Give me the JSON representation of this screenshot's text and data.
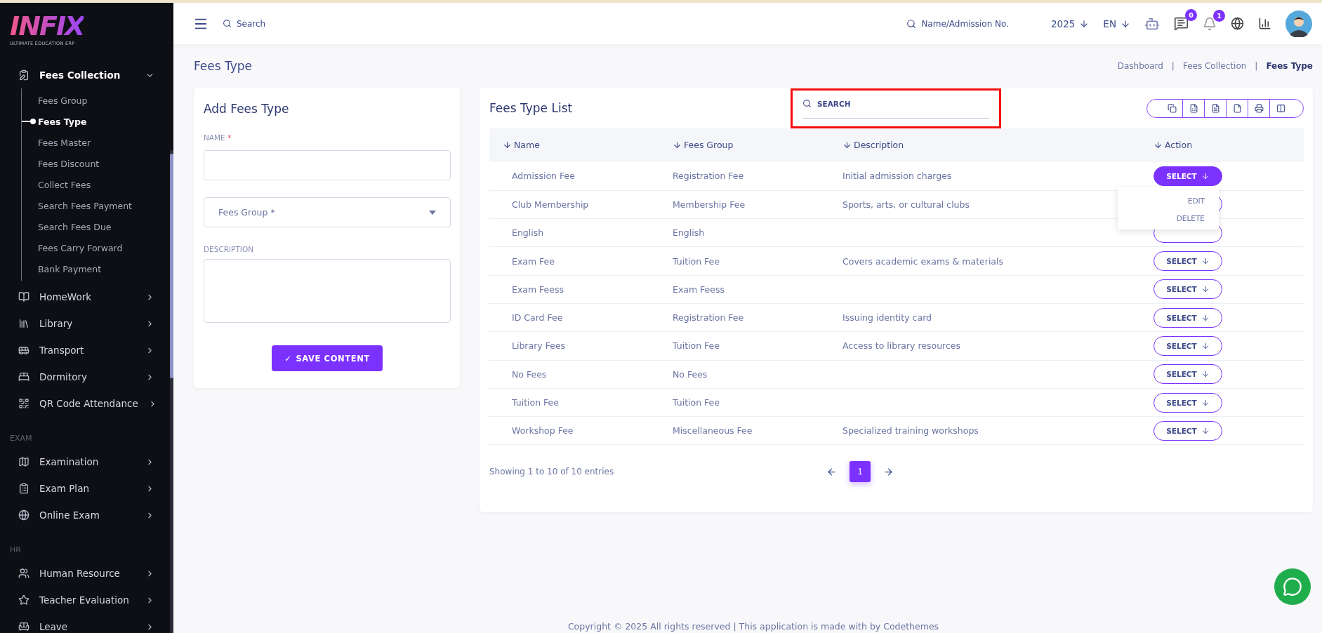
{
  "sidebar": {
    "logo": {
      "brand": "INFIX",
      "tagline": "ULTIMATE EDUCATION ERP"
    },
    "sections": [
      {
        "items": [
          {
            "label": "Fees Collection",
            "expanded": true,
            "children": [
              {
                "label": "Fees Group",
                "selected": false
              },
              {
                "label": "Fees Type",
                "selected": true
              },
              {
                "label": "Fees Master",
                "selected": false
              },
              {
                "label": "Fees Discount",
                "selected": false
              },
              {
                "label": "Collect Fees",
                "selected": false
              },
              {
                "label": "Search Fees Payment",
                "selected": false
              },
              {
                "label": "Search Fees Due",
                "selected": false
              },
              {
                "label": "Fees Carry Forward",
                "selected": false
              },
              {
                "label": "Bank Payment",
                "selected": false
              }
            ]
          },
          {
            "label": "HomeWork",
            "expanded": false
          },
          {
            "label": "Library",
            "expanded": false
          },
          {
            "label": "Transport",
            "expanded": false
          },
          {
            "label": "Dormitory",
            "expanded": false
          },
          {
            "label": "QR Code Attendance",
            "expanded": false
          }
        ]
      },
      {
        "heading": "EXAM",
        "items": [
          {
            "label": "Examination",
            "expanded": false
          },
          {
            "label": "Exam Plan",
            "expanded": false
          },
          {
            "label": "Online Exam",
            "expanded": false
          }
        ]
      },
      {
        "heading": "HR",
        "items": [
          {
            "label": "Human Resource",
            "expanded": false
          },
          {
            "label": "Teacher Evaluation",
            "expanded": false
          },
          {
            "label": "Leave",
            "expanded": false
          }
        ]
      }
    ]
  },
  "header": {
    "search": {
      "placeholder": "Search"
    },
    "student_search": {
      "placeholder": "Name/Admission No."
    },
    "year": "2025",
    "language": "EN",
    "chat_badge": "0",
    "notification_badge": "1"
  },
  "page": {
    "title": "Fees Type",
    "separator": "|",
    "breadcrumb": [
      {
        "label": "Dashboard",
        "current": false
      },
      {
        "label": "Fees Collection",
        "current": false
      },
      {
        "label": "Fees Type",
        "current": true
      }
    ]
  },
  "form": {
    "title": "Add Fees Type",
    "name_label": "NAME",
    "required_mark": "*",
    "fees_group": {
      "placeholder": "Fees Group *"
    },
    "description_label": "DESCRIPTION",
    "save_button": "SAVE CONTENT",
    "save_icon": "✓"
  },
  "list": {
    "title": "Fees Type List",
    "search": {
      "placeholder": "SEARCH"
    },
    "columns": [
      "Name",
      "Fees Group",
      "Description",
      "Action"
    ],
    "rows": [
      {
        "name": "Admission Fee",
        "group": "Registration Fee",
        "description": "Initial admission charges",
        "action": "SELECT",
        "open": true
      },
      {
        "name": "Club Membership",
        "group": "Membership Fee",
        "description": "Sports, arts, or cultural clubs",
        "open": false
      },
      {
        "name": "English",
        "group": "English",
        "open": false
      },
      {
        "name": "Exam Fee",
        "group": "Tuition Fee",
        "description": "Covers academic exams & materials",
        "action": "SELECT",
        "open": false
      },
      {
        "name": "Exam Feess",
        "group": "Exam Feess",
        "action": "SELECT",
        "open": false
      },
      {
        "name": "ID Card Fee",
        "group": "Registration Fee",
        "description": "Issuing identity card",
        "action": "SELECT",
        "open": false
      },
      {
        "name": "Library Fees",
        "group": "Tuition Fee",
        "description": "Access to library resources",
        "action": "SELECT",
        "open": false
      },
      {
        "name": "No Fees",
        "group": "No Fees",
        "action": "SELECT",
        "open": false
      },
      {
        "name": "Tuition Fee",
        "group": "Tuition Fee",
        "action": "SELECT",
        "open": false
      },
      {
        "name": "Workshop Fee",
        "group": "Miscellaneous Fee",
        "description": "Specialized training workshops",
        "action": "SELECT",
        "open": false
      }
    ],
    "action_menu": [
      "EDIT",
      "DELETE"
    ],
    "info": "Showing 1 to 10 of 10 entries",
    "pages": [
      {
        "label": "1",
        "selected": true
      }
    ]
  },
  "footer": "Copyright © 2025 All rights reserved | This application is made with by Codethemes"
}
